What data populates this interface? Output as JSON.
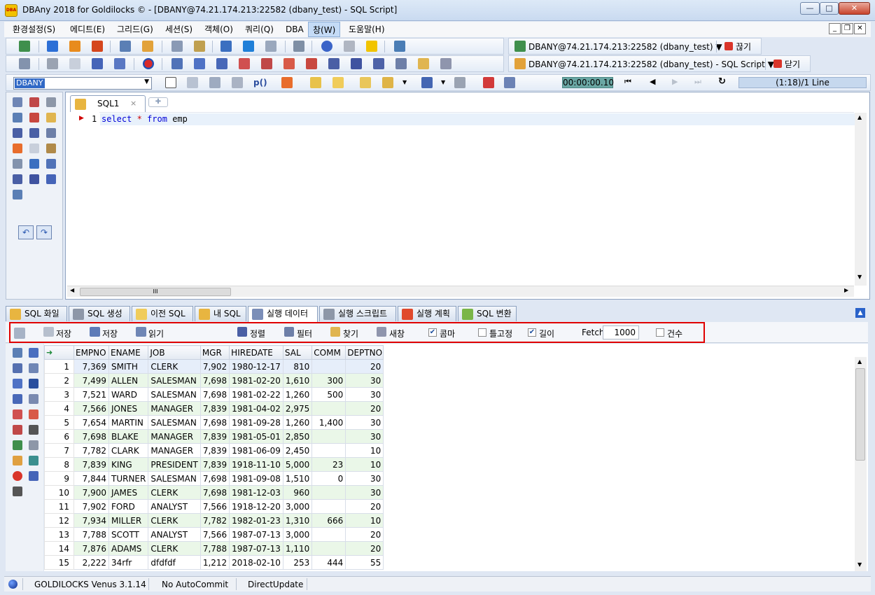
{
  "window": {
    "title": "DBAny 2018 for Goldilocks © - [DBANY@74.21.174.213:22582 (dbany_test) - SQL Script]",
    "app_icon_text": "DBA"
  },
  "menubar": {
    "items": [
      "환경설정(S)",
      "에디트(E)",
      "그리드(G)",
      "세션(S)",
      "객체(O)",
      "쿼리(Q)",
      "DBA",
      "창(W)",
      "도움말(H)"
    ],
    "active": "창(W)"
  },
  "toolbar1": {
    "connection": "DBANY@74.21.174.213:22582 (dbany_test) ▼",
    "disconnect": "끊기"
  },
  "toolbar2": {
    "script": "DBANY@74.21.174.213:22582 (dbany_test) - SQL Script ▼",
    "close": "닫기"
  },
  "toolbar3": {
    "schema": "DBANY",
    "proc_label": "p()",
    "timer": "00:00:00.10",
    "position": "(1:18)/1 Line"
  },
  "editor": {
    "tab": "SQL1",
    "line_no": "1",
    "code": {
      "kw1": "select",
      "star": "*",
      "kw2": "from",
      "table": "emp"
    },
    "hscroll_grip": "III"
  },
  "bottom_tabs": [
    "SQL 화일",
    "SQL 생성",
    "이전 SQL",
    "내 SQL",
    "실행 데이터",
    "실행 스크립트",
    "실행 계획",
    "SQL 변환"
  ],
  "active_tab": "실행 데이터",
  "result_toolbar": {
    "save1": "저장",
    "save2": "저장",
    "read": "읽기",
    "sort": "정렬",
    "filter": "필터",
    "find": "찾기",
    "new_window": "새창",
    "comma": "콤마",
    "comma_checked": true,
    "fixed": "틀고정",
    "fixed_checked": false,
    "length": "길이",
    "length_checked": true,
    "fetch_label": "Fetch",
    "fetch_value": "1000",
    "count": "건수",
    "count_checked": false
  },
  "grid": {
    "columns": [
      "EMPNO",
      "ENAME",
      "JOB",
      "MGR",
      "HIREDATE",
      "SAL",
      "COMM",
      "DEPTNO"
    ],
    "rows": [
      [
        "1",
        "7,369",
        "SMITH",
        "CLERK",
        "7,902",
        "1980-12-17",
        "810",
        "",
        "20"
      ],
      [
        "2",
        "7,499",
        "ALLEN",
        "SALESMAN",
        "7,698",
        "1981-02-20",
        "1,610",
        "300",
        "30"
      ],
      [
        "3",
        "7,521",
        "WARD",
        "SALESMAN",
        "7,698",
        "1981-02-22",
        "1,260",
        "500",
        "30"
      ],
      [
        "4",
        "7,566",
        "JONES",
        "MANAGER",
        "7,839",
        "1981-04-02",
        "2,975",
        "",
        "20"
      ],
      [
        "5",
        "7,654",
        "MARTIN",
        "SALESMAN",
        "7,698",
        "1981-09-28",
        "1,260",
        "1,400",
        "30"
      ],
      [
        "6",
        "7,698",
        "BLAKE",
        "MANAGER",
        "7,839",
        "1981-05-01",
        "2,850",
        "",
        "30"
      ],
      [
        "7",
        "7,782",
        "CLARK",
        "MANAGER",
        "7,839",
        "1981-06-09",
        "2,450",
        "",
        "10"
      ],
      [
        "8",
        "7,839",
        "KING",
        "PRESIDENT",
        "7,839",
        "1918-11-10",
        "5,000",
        "23",
        "10"
      ],
      [
        "9",
        "7,844",
        "TURNER",
        "SALESMAN",
        "7,698",
        "1981-09-08",
        "1,510",
        "0",
        "30"
      ],
      [
        "10",
        "7,900",
        "JAMES",
        "CLERK",
        "7,698",
        "1981-12-03",
        "960",
        "",
        "30"
      ],
      [
        "11",
        "7,902",
        "FORD",
        "ANALYST",
        "7,566",
        "1918-12-20",
        "3,000",
        "",
        "20"
      ],
      [
        "12",
        "7,934",
        "MILLER",
        "CLERK",
        "7,782",
        "1982-01-23",
        "1,310",
        "666",
        "10"
      ],
      [
        "13",
        "7,788",
        "SCOTT",
        "ANALYST",
        "7,566",
        "1987-07-13",
        "3,000",
        "",
        "20"
      ],
      [
        "14",
        "7,876",
        "ADAMS",
        "CLERK",
        "7,788",
        "1987-07-13",
        "1,110",
        "",
        "20"
      ],
      [
        "15",
        "2,222",
        "34rfr",
        "dfdfdf",
        "1,212",
        "2018-02-10",
        "253",
        "444",
        "55"
      ]
    ]
  },
  "status": {
    "db": "GOLDILOCKS Venus 3.1.14",
    "autocommit": "No AutoCommit",
    "mode": "DirectUpdate"
  },
  "colors": {
    "highlight": "#e00000",
    "timer_bg": "#6aa7a4",
    "menu_active": "#c4dbf6",
    "row_alt": "#eaf7e8"
  }
}
